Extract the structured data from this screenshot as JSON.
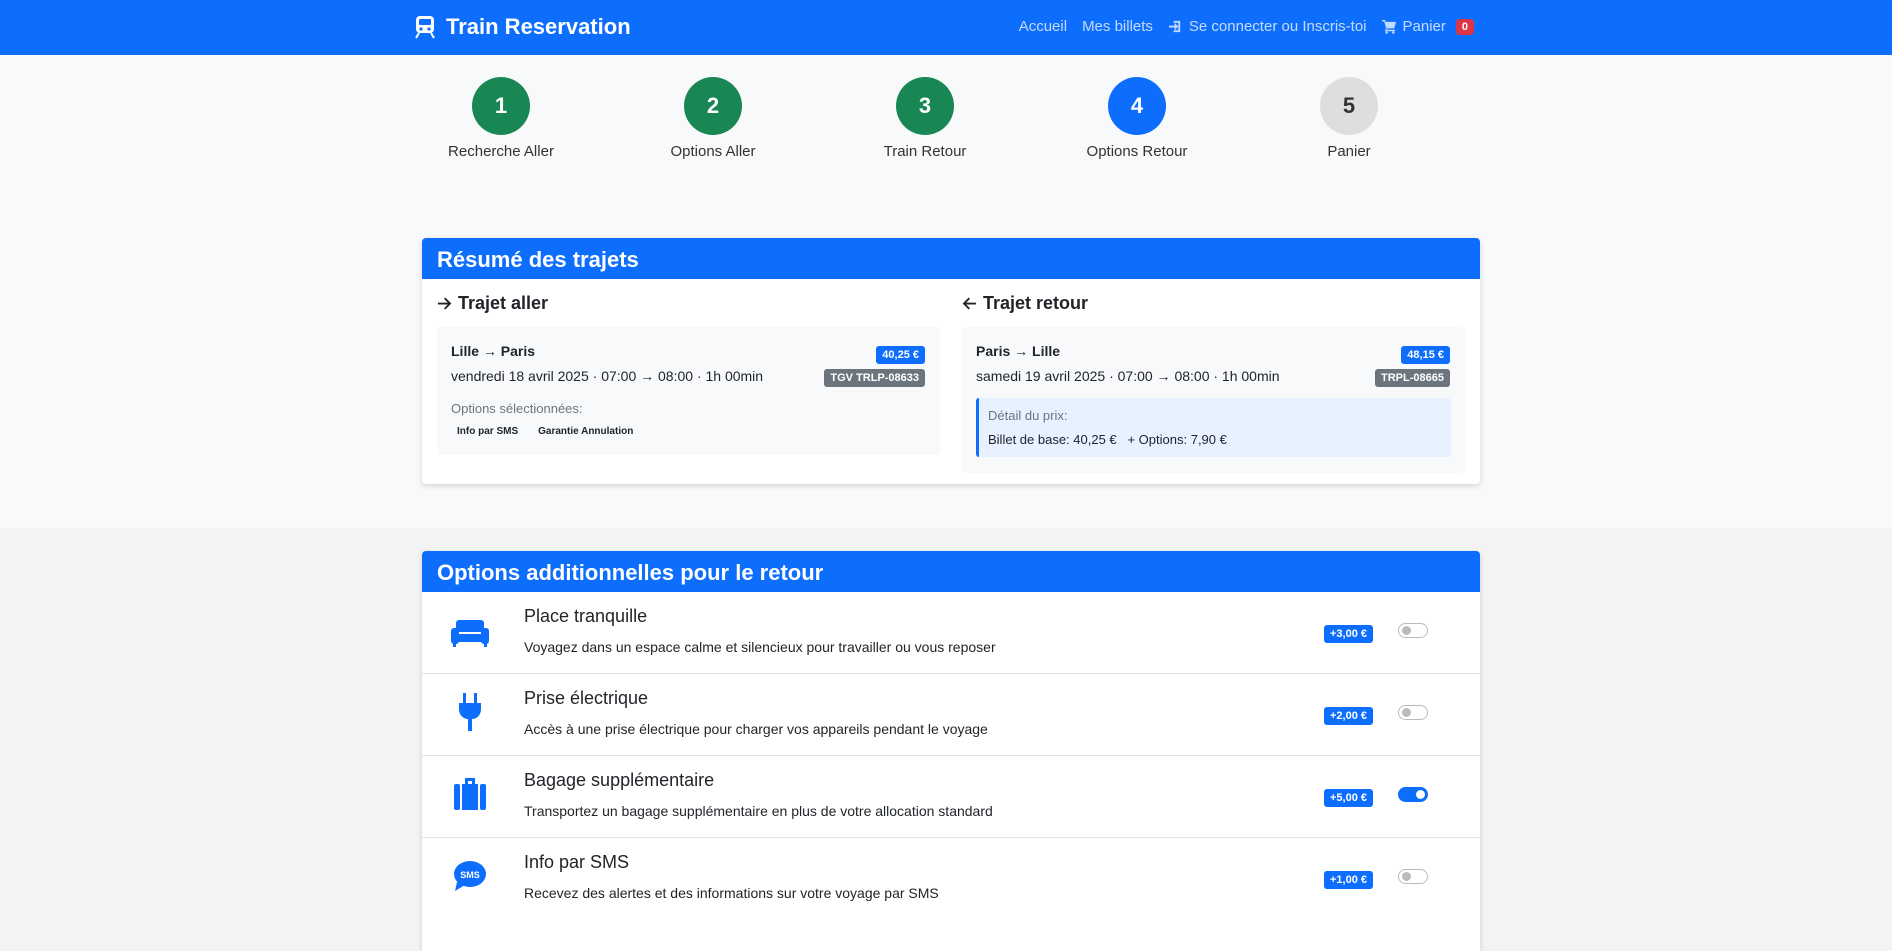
{
  "navbar": {
    "brand": "Train Reservation",
    "links": {
      "home": "Accueil",
      "tickets": "Mes billets",
      "login": "Se connecter ou Inscris-toi",
      "cart": "Panier",
      "cart_count": "0"
    }
  },
  "stepper": [
    {
      "number": "1",
      "label": "Recherche Aller",
      "status": "done"
    },
    {
      "number": "2",
      "label": "Options Aller",
      "status": "done"
    },
    {
      "number": "3",
      "label": "Train Retour",
      "status": "done"
    },
    {
      "number": "4",
      "label": "Options Retour",
      "status": "active"
    },
    {
      "number": "5",
      "label": "Panier",
      "status": "todo"
    }
  ],
  "summary": {
    "title": "Résumé des trajets",
    "outbound": {
      "heading": "Trajet aller",
      "route": "Lille → Paris",
      "when": "vendredi 18 avril 2025 · 07:00 → 08:00 · 1h 00min",
      "price": "40,25 €",
      "train": "TGV TRLP-08633",
      "options_title": "Options sélectionnées:",
      "options": [
        "Info par SMS",
        "Garantie Annulation"
      ]
    },
    "return": {
      "heading": "Trajet retour",
      "route": "Paris → Lille",
      "when": "samedi 19 avril 2025 · 07:00 → 08:00 · 1h 00min",
      "price": "48,15 €",
      "train": "TRPL-08665",
      "price_detail_title": "Détail du prix:",
      "price_detail": "Billet de base: 40,25 €   + Options: 7,90 €"
    }
  },
  "options_card": {
    "title": "Options additionnelles pour le retour",
    "items": [
      {
        "name": "Place tranquille",
        "description": "Voyagez dans un espace calme et silencieux pour travailler ou vous reposer",
        "price": "+3,00 €",
        "enabled": false,
        "icon": "couch-icon"
      },
      {
        "name": "Prise électrique",
        "description": "Accès à une prise électrique pour charger vos appareils pendant le voyage",
        "price": "+2,00 €",
        "enabled": false,
        "icon": "plug-icon"
      },
      {
        "name": "Bagage supplémentaire",
        "description": "Transportez un bagage supplémentaire en plus de votre allocation standard",
        "price": "+5,00 €",
        "enabled": true,
        "icon": "suitcase-icon"
      },
      {
        "name": "Info par SMS",
        "description": "Recevez des alertes et des informations sur votre voyage par SMS",
        "price": "+1,00 €",
        "enabled": false,
        "icon": "sms-icon"
      }
    ]
  },
  "colors": {
    "primary": "#0d6efd",
    "done": "#198754",
    "todo": "#dedede"
  }
}
